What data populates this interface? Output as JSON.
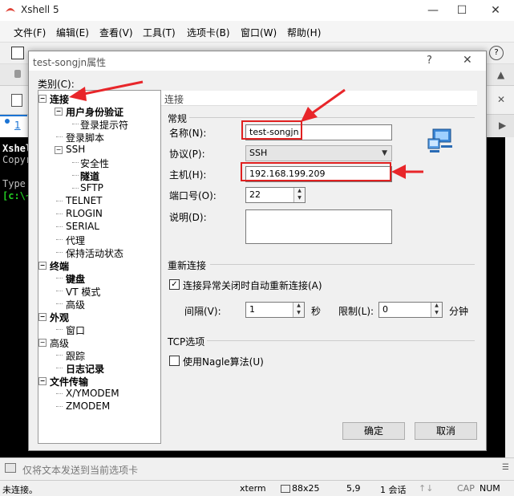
{
  "app": {
    "title": "Xshell 5",
    "menu": [
      "文件(F)",
      "编辑(E)",
      "查看(V)",
      "工具(T)",
      "选项卡(B)",
      "窗口(W)",
      "帮助(H)"
    ]
  },
  "tabs": {
    "active_label": "1"
  },
  "terminal": {
    "lines": [
      "Xshel",
      "Copyr",
      "",
      "Type",
      "[c:\\~"
    ]
  },
  "sendbar": {
    "placeholder": "仅将文本发送到当前选项卡"
  },
  "status": {
    "connection": "未连接。",
    "term": "xterm",
    "size": "88x25",
    "position": "5,9",
    "sessions": "1 会话",
    "caps": "CAP",
    "num": "NUM"
  },
  "dialog": {
    "title": "test-songjn属性",
    "help_glyph": "?",
    "close_glyph": "✕",
    "category_label": "类别(C):",
    "tree": [
      {
        "label": "连接",
        "level": 0,
        "bold": true,
        "expander": "−"
      },
      {
        "label": "用户身份验证",
        "level": 1,
        "bold": true,
        "expander": "−"
      },
      {
        "label": "登录提示符",
        "level": 2,
        "bold": false
      },
      {
        "label": "登录脚本",
        "level": 1,
        "bold": false
      },
      {
        "label": "SSH",
        "level": 1,
        "bold": false,
        "expander": "−"
      },
      {
        "label": "安全性",
        "level": 2,
        "bold": false
      },
      {
        "label": "隧道",
        "level": 2,
        "bold": true
      },
      {
        "label": "SFTP",
        "level": 2,
        "bold": false
      },
      {
        "label": "TELNET",
        "level": 1,
        "bold": false
      },
      {
        "label": "RLOGIN",
        "level": 1,
        "bold": false
      },
      {
        "label": "SERIAL",
        "level": 1,
        "bold": false
      },
      {
        "label": "代理",
        "level": 1,
        "bold": false
      },
      {
        "label": "保持活动状态",
        "level": 1,
        "bold": false
      },
      {
        "label": "终端",
        "level": 0,
        "bold": true,
        "expander": "−"
      },
      {
        "label": "键盘",
        "level": 1,
        "bold": true
      },
      {
        "label": "VT 模式",
        "level": 1,
        "bold": false
      },
      {
        "label": "高级",
        "level": 1,
        "bold": false
      },
      {
        "label": "外观",
        "level": 0,
        "bold": true,
        "expander": "−"
      },
      {
        "label": "窗口",
        "level": 1,
        "bold": false
      },
      {
        "label": "高级",
        "level": 0,
        "bold": false,
        "expander": "−"
      },
      {
        "label": "跟踪",
        "level": 1,
        "bold": false
      },
      {
        "label": "日志记录",
        "level": 1,
        "bold": true
      },
      {
        "label": "文件传输",
        "level": 0,
        "bold": true,
        "expander": "−"
      },
      {
        "label": "X/YMODEM",
        "level": 1,
        "bold": false
      },
      {
        "label": "ZMODEM",
        "level": 1,
        "bold": false
      }
    ],
    "panel_header": "连接",
    "general": {
      "title": "常规",
      "name_label": "名称(N):",
      "name_value": "test-songjn",
      "protocol_label": "协议(P):",
      "protocol_value": "SSH",
      "host_label": "主机(H):",
      "host_value": "192.168.199.209",
      "port_label": "端口号(O):",
      "port_value": "22",
      "desc_label": "说明(D):",
      "desc_value": ""
    },
    "reconnect": {
      "title": "重新连接",
      "auto_label": "连接异常关闭时自动重新连接(A)",
      "auto_checked": true,
      "interval_label": "间隔(V):",
      "interval_value": "1",
      "interval_unit": "秒",
      "limit_label": "限制(L):",
      "limit_value": "0",
      "limit_unit": "分钟"
    },
    "tcp": {
      "title": "TCP选项",
      "nagle_label": "使用Nagle算法(U)",
      "nagle_checked": false
    },
    "ok_label": "确定",
    "cancel_label": "取消"
  },
  "colors": {
    "highlight": "#e02020",
    "terminal_bg": "#000000",
    "prompt_green": "#22cc22"
  }
}
